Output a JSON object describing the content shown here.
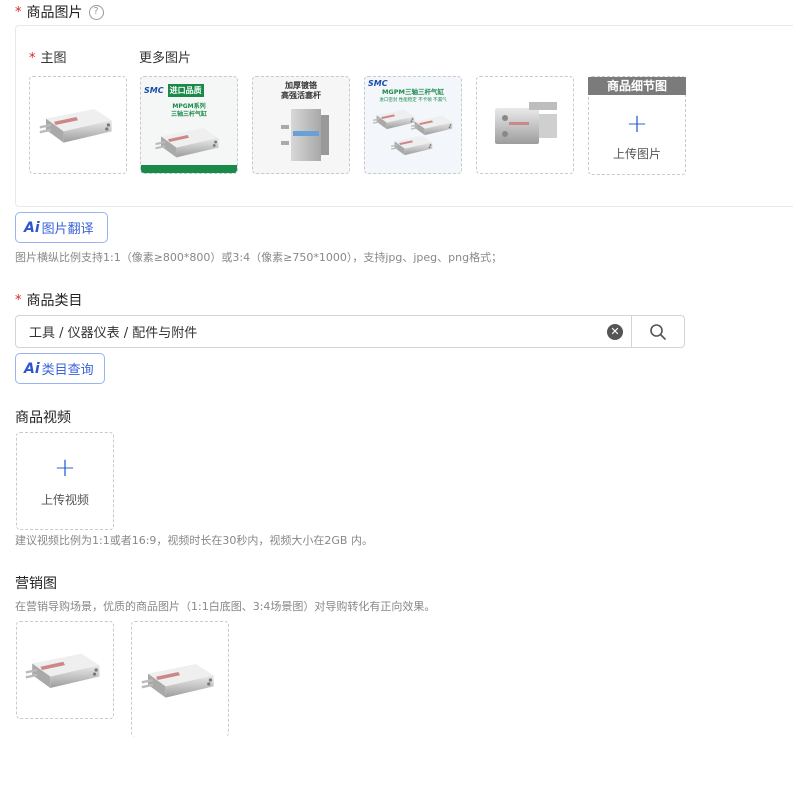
{
  "product_images": {
    "label": "商品图片",
    "help_icon": "question-circle-icon",
    "main_label": "主图",
    "more_label": "更多图片",
    "detail_header": "商品细节图",
    "upload_label": "上传图片",
    "thumb2_text": [
      "进口品质",
      "MPGM系列",
      "三轴三杆气缸",
      "SMC"
    ],
    "thumb3_text": [
      "加厚镀铬",
      "高强活塞杆"
    ],
    "thumb4_text": [
      "MGPM三轴三杆气缸",
      "进口密封 性能稳定 不卡顿 不漏气",
      "SMC"
    ],
    "ai_translate_label": "图片翻译",
    "hint": "图片横纵比例支持1:1（像素≥800*800）或3:4（像素≥750*1000），支持jpg、jpeg、png格式；"
  },
  "category": {
    "label": "商品类目",
    "value": "工具 / 仪器仪表 / 配件与附件",
    "ai_query_label": "类目查询"
  },
  "video": {
    "label": "商品视频",
    "upload_label": "上传视频",
    "hint": "建议视频比例为1:1或者16:9，视频时长在30秒内，视频大小在2GB 内。"
  },
  "marketing": {
    "label": "营销图",
    "hint": "在营销导购场景，优质的商品图片（1:1白底图、3:4场景图）对导购转化有正向效果。"
  },
  "ai_badge": "Ai",
  "colors": {
    "required": "#e02020",
    "accent": "#2f5fd6",
    "ai_border": "#9ab4ef"
  }
}
